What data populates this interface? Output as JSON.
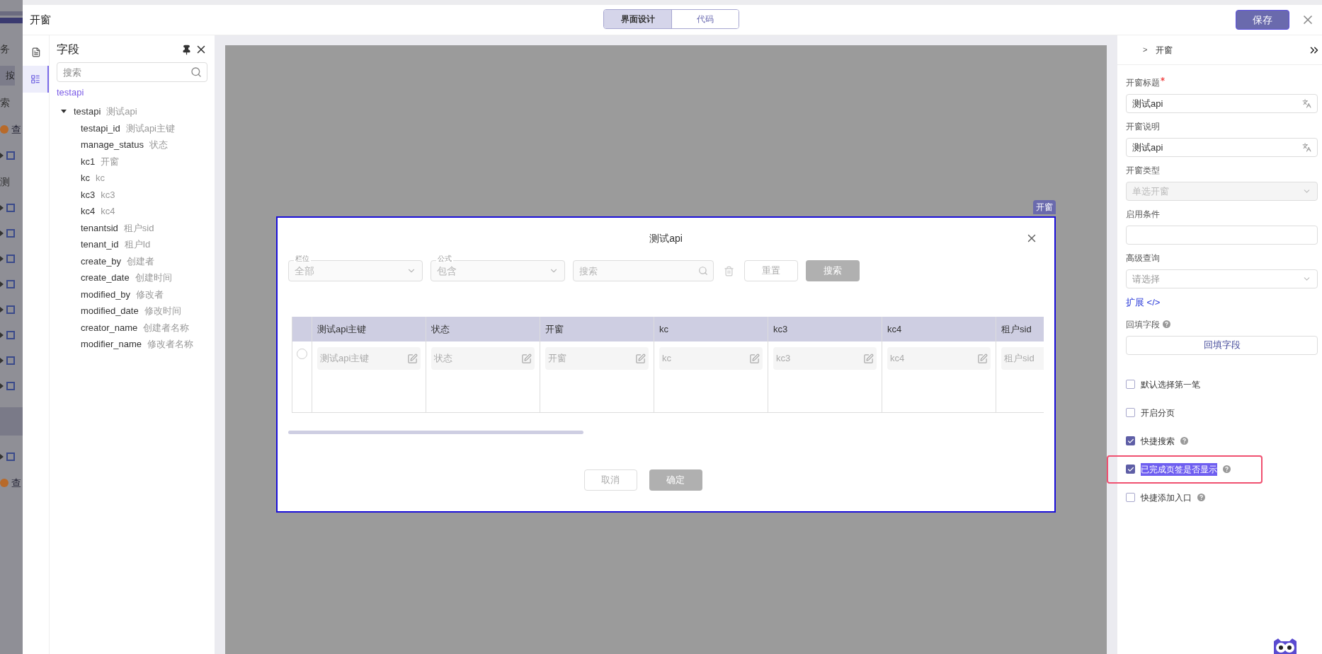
{
  "background_app": {
    "rows": [
      {
        "kind": "logo"
      },
      {
        "kind": "text",
        "text": "务"
      },
      {
        "kind": "button",
        "text": "按"
      },
      {
        "kind": "text",
        "text": "索"
      },
      {
        "kind": "icon-text",
        "text": "查"
      },
      {
        "kind": "tree-icon"
      },
      {
        "kind": "text",
        "text": "测"
      },
      {
        "kind": "tree-icon"
      },
      {
        "kind": "tree-icon"
      },
      {
        "kind": "tree-icon"
      },
      {
        "kind": "tree-icon"
      },
      {
        "kind": "tree-icon"
      },
      {
        "kind": "tree-icon"
      },
      {
        "kind": "tree-icon"
      },
      {
        "kind": "tree-icon"
      },
      {
        "kind": "band"
      },
      {
        "kind": "tree-icon"
      },
      {
        "kind": "icon-text",
        "text": "查"
      }
    ]
  },
  "header": {
    "title": "开窗",
    "tabs": [
      {
        "label": "界面设计",
        "selected": true
      },
      {
        "label": "代码",
        "selected": false
      }
    ],
    "save": "保存"
  },
  "rail": [
    {
      "kind": "page",
      "selected": false
    },
    {
      "kind": "fields",
      "selected": true
    }
  ],
  "fields_panel": {
    "title": "字段",
    "search": {
      "placeholder": "搜索"
    },
    "root": "testapi",
    "tree": [
      {
        "name": "testapi",
        "label": "测试api",
        "expanded": true,
        "children": [
          {
            "name": "testapi_id",
            "label": "测试api主键"
          },
          {
            "name": "manage_status",
            "label": "状态"
          },
          {
            "name": "kc1",
            "label": "开窗"
          },
          {
            "name": "kc",
            "label": "kc"
          },
          {
            "name": "kc3",
            "label": "kc3"
          },
          {
            "name": "kc4",
            "label": "kc4"
          },
          {
            "name": "tenantsid",
            "label": "租户sid"
          },
          {
            "name": "tenant_id",
            "label": "租户Id"
          },
          {
            "name": "create_by",
            "label": "创建者"
          },
          {
            "name": "create_date",
            "label": "创建时间"
          },
          {
            "name": "modified_by",
            "label": "修改者"
          },
          {
            "name": "modified_date",
            "label": "修改时间"
          },
          {
            "name": "creator_name",
            "label": "创建者名称"
          },
          {
            "name": "modifier_name",
            "label": "修改者名称"
          }
        ]
      }
    ]
  },
  "modal": {
    "badge": "开窗",
    "title": "测试api",
    "filters": [
      {
        "kind": "select",
        "label": "栏位",
        "value": "全部"
      },
      {
        "kind": "select",
        "label": "公式",
        "value": "包含"
      },
      {
        "kind": "search",
        "placeholder": "搜索"
      }
    ],
    "buttons": [
      {
        "label": "重置",
        "primary": false
      },
      {
        "label": "搜索",
        "primary": true
      }
    ],
    "table": {
      "columns": [
        "测试api主键",
        "状态",
        "开窗",
        "kc",
        "kc3",
        "kc4",
        "租户sid"
      ],
      "rows": [
        {
          "selected": false,
          "cells": [
            "测试api主键",
            "状态",
            "开窗",
            "kc",
            "kc3",
            "kc4",
            "租户sid"
          ]
        }
      ]
    },
    "footer": [
      {
        "label": "取消",
        "primary": false
      },
      {
        "label": "确定",
        "primary": true
      }
    ]
  },
  "properties": {
    "breadcrumb": [
      ">",
      "开窗"
    ],
    "fields": [
      {
        "kind": "input",
        "label": "开窗标题",
        "required": true,
        "value": "测试api",
        "translate": true
      },
      {
        "kind": "input",
        "label": "开窗说明",
        "required": false,
        "value": "测试api",
        "translate": true
      },
      {
        "kind": "select",
        "label": "开窗类型",
        "required": false,
        "value": "单选开窗",
        "disabled": true
      },
      {
        "kind": "input",
        "label": "启用条件",
        "required": false,
        "translate": false
      },
      {
        "kind": "select",
        "label": "高级查询",
        "required": false,
        "placeholder": "请选择",
        "disabled": false
      },
      {
        "kind": "link",
        "text": "扩展 </>"
      },
      {
        "kind": "button",
        "label": "回填字段",
        "help": true,
        "button": "回填字段"
      }
    ],
    "options": [
      {
        "label": "默认选择第一笔",
        "checked": false,
        "help": false,
        "text_selected": false,
        "annotated": false
      },
      {
        "label": "开启分页",
        "checked": false,
        "help": false,
        "text_selected": false,
        "annotated": false
      },
      {
        "label": "快捷搜索",
        "checked": true,
        "help": true,
        "text_selected": false,
        "annotated": false
      },
      {
        "label": "已完成页签是否显示",
        "checked": true,
        "help": true,
        "text_selected": true,
        "annotated": true
      },
      {
        "label": "快捷添加入口",
        "checked": false,
        "help": true,
        "text_selected": false,
        "annotated": false
      }
    ]
  }
}
